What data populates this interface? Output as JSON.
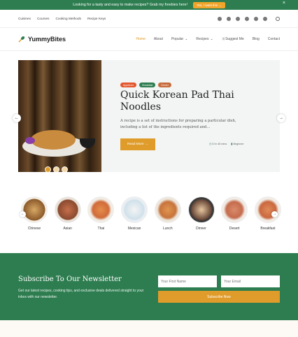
{
  "banner": {
    "message": "Looking for a tasty and easy to make recipes? Grab my freebies here!",
    "cta": "Yes, I want this →",
    "close": "×"
  },
  "util_links": [
    "Cuisines",
    "Courses",
    "Cooking Methods",
    "Recipe Keys"
  ],
  "socials": [
    "facebook-icon",
    "instagram-icon",
    "twitter-icon",
    "pinterest-icon",
    "youtube-icon",
    "tiktok-icon"
  ],
  "logo": {
    "text": "YummyBites"
  },
  "nav": {
    "home": "Home",
    "about": "About",
    "popular": "Popular",
    "recipes": "Recipes",
    "suggest": "Suggest Me",
    "blog": "Blog",
    "contact": "Contact"
  },
  "hero": {
    "tags": [
      {
        "label": "Appetizer",
        "color": "#e4572e"
      },
      {
        "label": "Breakfast",
        "color": "#2e7d50"
      },
      {
        "label": "Dinner",
        "color": "#c86b3c"
      }
    ],
    "title": "Quick Korean Pad Thai Noodles",
    "description": "A recipe is a set of instructions for preparing a particular dish, including a list of the ingredients required and…",
    "cta": "Read More →",
    "time": "5 hr 45 mins",
    "level": "Beginner"
  },
  "categories": [
    "Chinese",
    "Asian",
    "Thai",
    "Mexican",
    "Lunch",
    "Dinner",
    "Desert",
    "Breakfast"
  ],
  "newsletter": {
    "title": "Subscribe To Our Newsletter",
    "description": "Get our latest recipes, cooking tips, and exclusive deals delivered straight to your inbox with our newsletter.",
    "first_name_placeholder": "Your First Name",
    "email_placeholder": "Your Email",
    "button": "Subscribe Now"
  },
  "colors": {
    "green": "#2e7d50",
    "accent": "#e09c2b"
  }
}
